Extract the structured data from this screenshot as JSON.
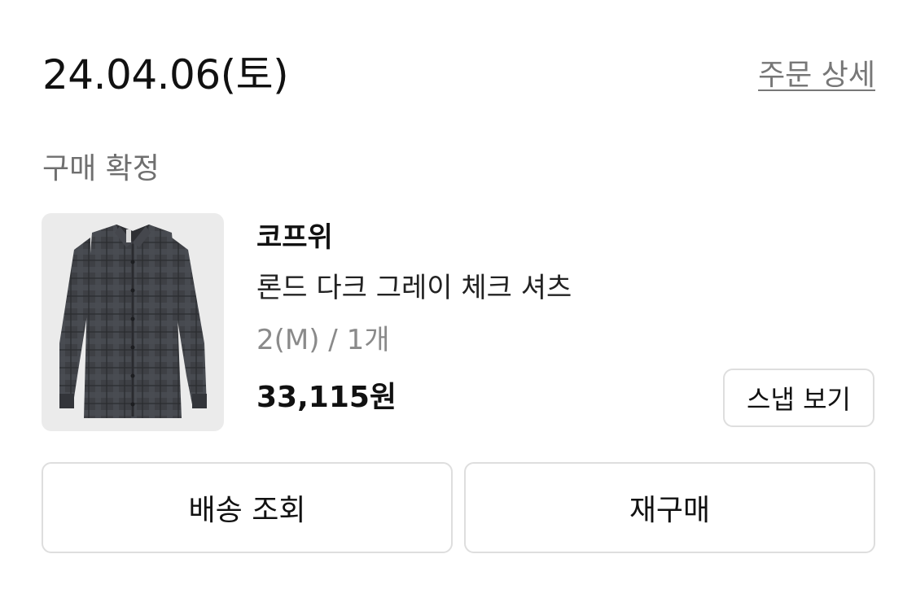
{
  "order": {
    "date": "24.04.06(토)",
    "detail_link": "주문 상세",
    "status": "구매 확정"
  },
  "product": {
    "image_icon": "checked-shirt-image",
    "brand": "코프위",
    "name": "론드 다크 그레이 체크 셔츠",
    "option": "2(M) / 1개",
    "price": "33,115원",
    "snap_button": "스냅 보기"
  },
  "actions": {
    "track_delivery": "배송 조회",
    "reorder": "재구매"
  },
  "colors": {
    "background": "#ffffff",
    "border": "#dedede",
    "muted_text": "#8a8a8a",
    "thumbnail_bg": "#ebebeb",
    "shirt": "#3f4146"
  }
}
